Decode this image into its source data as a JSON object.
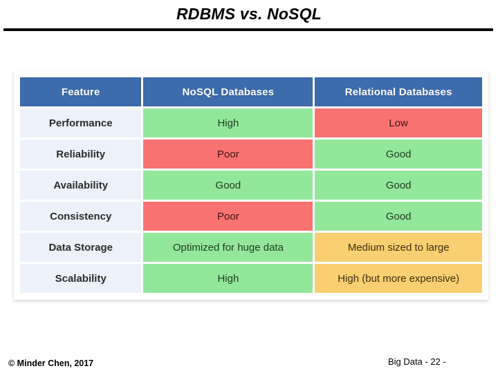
{
  "slide": {
    "title": "RDBMS vs. NoSQL"
  },
  "table": {
    "headers": [
      "Feature",
      "NoSQL Databases",
      "Relational Databases"
    ],
    "rows": [
      {
        "feature": "Performance",
        "nosql": {
          "text": "High",
          "status": "green"
        },
        "relational": {
          "text": "Low",
          "status": "red"
        }
      },
      {
        "feature": "Reliability",
        "nosql": {
          "text": "Poor",
          "status": "red"
        },
        "relational": {
          "text": "Good",
          "status": "green"
        }
      },
      {
        "feature": "Availability",
        "nosql": {
          "text": "Good",
          "status": "green"
        },
        "relational": {
          "text": "Good",
          "status": "green"
        }
      },
      {
        "feature": "Consistency",
        "nosql": {
          "text": "Poor",
          "status": "red"
        },
        "relational": {
          "text": "Good",
          "status": "green"
        }
      },
      {
        "feature": "Data Storage",
        "nosql": {
          "text": "Optimized for huge data",
          "status": "green"
        },
        "relational": {
          "text": "Medium sized to large",
          "status": "orange"
        }
      },
      {
        "feature": "Scalability",
        "nosql": {
          "text": "High",
          "status": "green"
        },
        "relational": {
          "text": "High (but more expensive)",
          "status": "orange"
        }
      }
    ]
  },
  "footer": {
    "copyright": "© Minder Chen, 2017",
    "slide_label": "Big Data - 22 -"
  },
  "colors": {
    "header_blue": "#3D6CAD",
    "feature_bg": "#EDF2FA",
    "green": "#93E79B",
    "red": "#F97272",
    "orange": "#F9CF72"
  }
}
